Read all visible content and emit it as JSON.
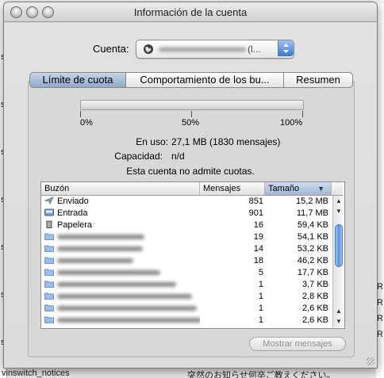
{
  "window": {
    "title": "Información de la cuenta"
  },
  "account": {
    "label": "Cuenta:",
    "value_suffix": "(l..."
  },
  "tabs": [
    {
      "label": "Límite de cuota",
      "active": true
    },
    {
      "label": "Comportamiento de los bu...",
      "active": false
    },
    {
      "label": "Resumen",
      "active": false
    }
  ],
  "quota": {
    "used_fraction": 0.0,
    "scale": [
      "0%",
      "50%",
      "100%"
    ],
    "in_use_label": "En uso:",
    "in_use_value": "27,1 MB (1830 mensajes)",
    "capacity_label": "Capacidad:",
    "capacity_value": "n/d",
    "note": "Esta cuenta no admite cuotas."
  },
  "table": {
    "headers": {
      "mailbox": "Buzón",
      "messages": "Mensajes",
      "size": "Tamaño"
    },
    "rows": [
      {
        "icon": "sent-mailbox-icon",
        "name": "Enviado",
        "messages": "851",
        "size": "15,2 MB"
      },
      {
        "icon": "inbox-icon",
        "name": "Entrada",
        "messages": "901",
        "size": "11,7 MB"
      },
      {
        "icon": "trash-icon",
        "name": "Papelera",
        "messages": "16",
        "size": "59,4 KB"
      },
      {
        "icon": "folder-icon",
        "name": "",
        "messages": "19",
        "size": "54,1 KB"
      },
      {
        "icon": "folder-icon",
        "name": "",
        "messages": "14",
        "size": "53,2 KB"
      },
      {
        "icon": "folder-icon",
        "name": "",
        "messages": "18",
        "size": "46,2 KB"
      },
      {
        "icon": "folder-icon",
        "name": "",
        "messages": "5",
        "size": "17,7 KB"
      },
      {
        "icon": "folder-icon",
        "name": "",
        "messages": "1",
        "size": "3,7 KB"
      },
      {
        "icon": "folder-icon",
        "name": "",
        "messages": "1",
        "size": "2,8 KB"
      },
      {
        "icon": "folder-icon",
        "name": "",
        "messages": "1",
        "size": "2,6 KB"
      },
      {
        "icon": "folder-icon",
        "name": "",
        "messages": "1",
        "size": "2,6 KB"
      }
    ]
  },
  "buttons": {
    "show_messages": "Mostrar mensajes"
  },
  "background": {
    "bottom_left": "vinswitch_notices",
    "bottom_right": "突然のお知らせ何卒ご教えください。"
  },
  "colors": {
    "accent": "#3a78d8",
    "selected_tab": "#a9bdd9"
  }
}
